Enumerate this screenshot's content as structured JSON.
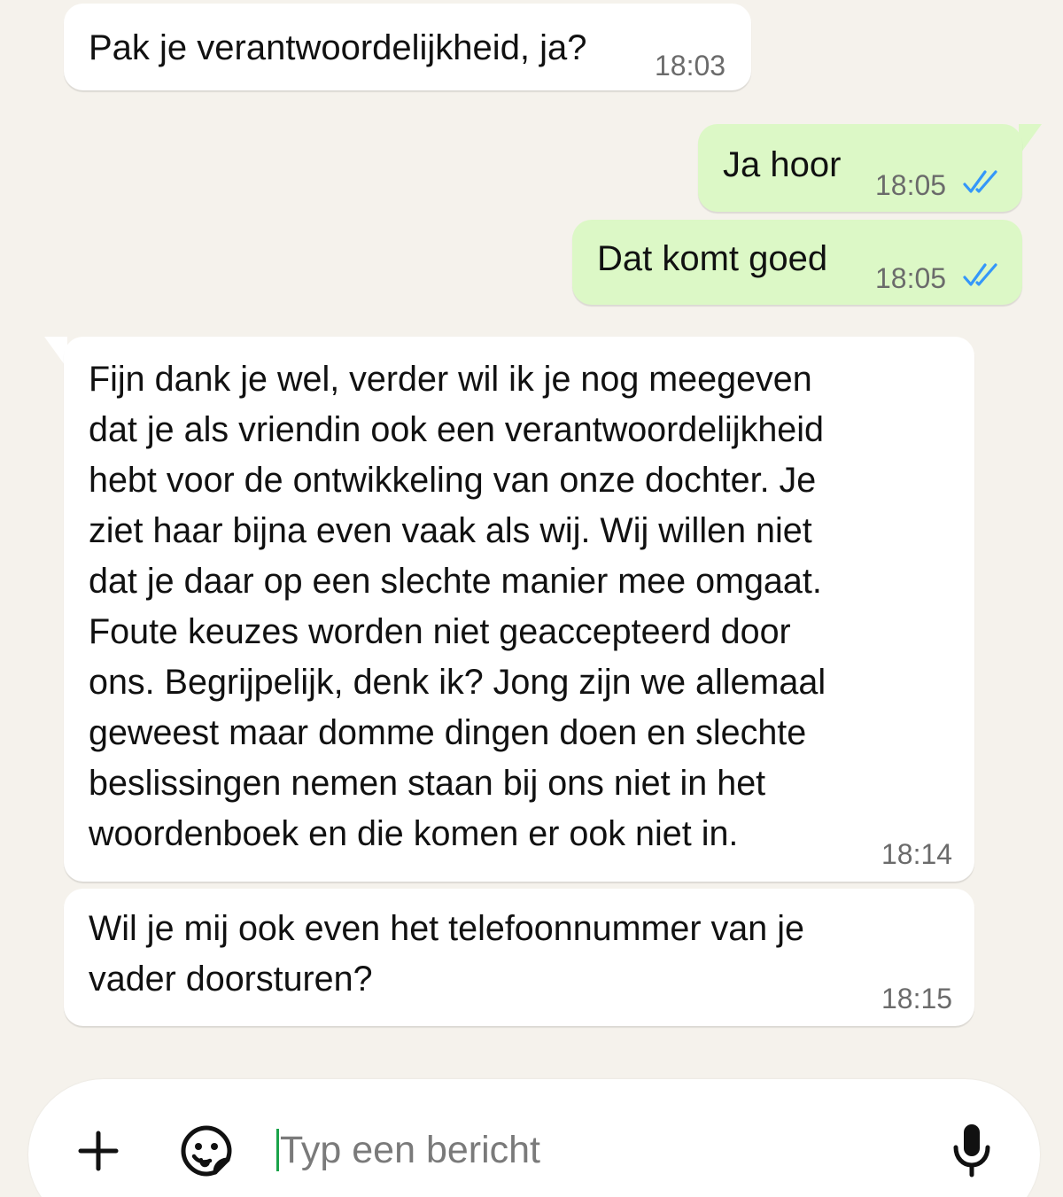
{
  "messages": [
    {
      "direction": "incoming",
      "text": "Pak je verantwoordelijkheid, ja?",
      "time": "18:03"
    },
    {
      "direction": "outgoing",
      "text": "Ja hoor",
      "time": "18:05",
      "status": "read"
    },
    {
      "direction": "outgoing",
      "text": "Dat komt goed",
      "time": "18:05",
      "status": "read"
    },
    {
      "direction": "incoming",
      "text": "Fijn dank je wel, verder wil ik je nog meegeven\ndat je als vriendin ook een verantwoordelijkheid\nhebt voor de ontwikkeling van onze dochter. Je\nziet haar bijna even vaak als wij. Wij willen niet\ndat je daar op een slechte manier mee omgaat.\nFoute keuzes worden niet geaccepteerd door\nons. Begrijpelijk, denk ik? Jong zijn we allemaal\ngeweest maar domme dingen doen en slechte\nbeslissingen nemen staan bij ons niet in het\nwoordenboek en die komen er ook niet in.",
      "time": "18:14"
    },
    {
      "direction": "incoming",
      "text": "Wil je mij ook even het telefoonnummer van je\nvader doorsturen?",
      "time": "18:15"
    }
  ],
  "composer": {
    "placeholder": "Typ een bericht",
    "attach_icon": "plus-icon",
    "sticker_icon": "sticker-icon",
    "voice_icon": "microphone-icon"
  },
  "colors": {
    "background": "#f5f2ec",
    "incoming_bubble": "#ffffff",
    "outgoing_bubble": "#dcf8c6",
    "read_ticks": "#3497f9",
    "caret": "#1aa34a"
  }
}
